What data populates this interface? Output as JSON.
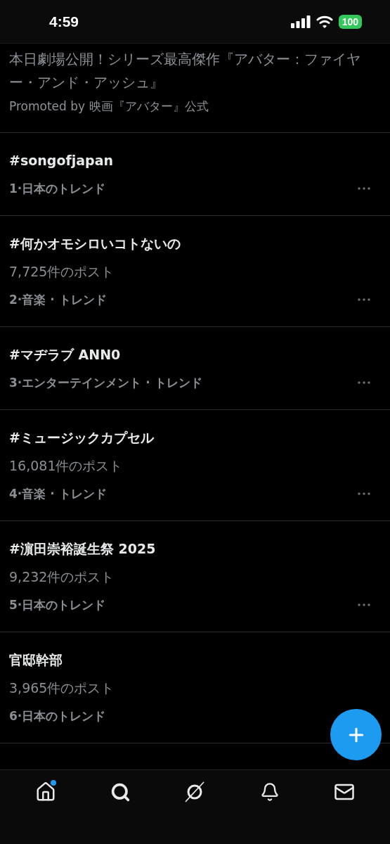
{
  "status_bar": {
    "time": "4:59",
    "battery": "100"
  },
  "promo": {
    "text": "本日劇場公開！シリーズ最高傑作『アバター：ファイヤー・アンド・アッシュ』",
    "promoted_by": "Promoted by 映画『アバター』公式"
  },
  "trends": [
    {
      "title": "#songofjapan",
      "meta": "1·日本のトレンド",
      "menu_visible": true
    },
    {
      "title": "#何かオモシロいコトないの",
      "posts": "7,725件のポスト",
      "meta": "2·音楽 · トレンド",
      "menu_visible": true
    },
    {
      "title": "#マヂラブ ANN0",
      "meta": "3·エンターテインメント · トレンド",
      "menu_visible": true
    },
    {
      "title": "#ミュージックカプセル",
      "posts": "16,081件のポスト",
      "meta": "4·音楽 · トレンド",
      "menu_visible": true
    },
    {
      "title": "#濵田崇裕誕生祭 2025",
      "posts": "9,232件のポスト",
      "meta": "5·日本のトレンド",
      "menu_visible": true
    },
    {
      "title": "官邸幹部",
      "posts": "3,965件のポスト",
      "meta": "6·日本のトレンド",
      "menu_visible": false
    }
  ],
  "nav": [
    {
      "kind": "home",
      "badge": true
    },
    {
      "kind": "search",
      "badge": false
    },
    {
      "kind": "grok",
      "badge": false
    },
    {
      "kind": "notifications",
      "badge": false
    },
    {
      "kind": "messages",
      "badge": false
    }
  ]
}
